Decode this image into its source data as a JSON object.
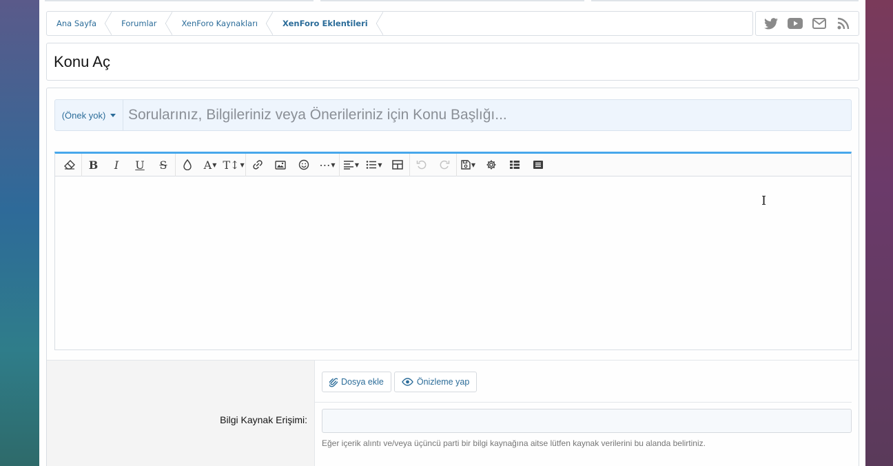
{
  "breadcrumb": {
    "items": [
      {
        "label": "Ana Sayfa"
      },
      {
        "label": "Forumlar"
      },
      {
        "label": "XenForo Kaynakları"
      },
      {
        "label": "XenForo Eklentileri"
      }
    ]
  },
  "social": {
    "icons": [
      "twitter-icon",
      "youtube-icon",
      "envelope-icon",
      "rss-icon"
    ]
  },
  "page": {
    "title": "Konu Aç"
  },
  "thread_form": {
    "prefix_label": "(Önek yok)",
    "title_placeholder": "Sorularınız, Bilgileriniz veya Önerileriniz için Konu Başlığı..."
  },
  "editor": {
    "toolbar": [
      "eraser-icon",
      "bold-icon",
      "italic-icon",
      "underline-icon",
      "strikethrough-icon",
      "color-drop-icon",
      "font-family-icon",
      "font-size-icon",
      "link-icon",
      "image-icon",
      "smiley-icon",
      "more-icon",
      "align-icon",
      "list-icon",
      "table-icon",
      "undo-icon",
      "redo-icon",
      "drafts-icon",
      "settings-icon",
      "bbcode-icon",
      "preview-list-icon"
    ]
  },
  "attachments": {
    "attach_label": "Dosya ekle",
    "preview_label": "Önizleme yap"
  },
  "source_field": {
    "label": "Bilgi Kaynak Erişimi:",
    "value": "",
    "hint": "Eğer içerik alıntı ve/veya üçüncü parti bir bilgi kaynağına aitse lütfen kaynak verilerini bu alanda belirtiniz."
  },
  "colors": {
    "link": "#2b6c99",
    "editor_accent": "#47a7eb",
    "title_row_bg": "#eef5fd"
  }
}
